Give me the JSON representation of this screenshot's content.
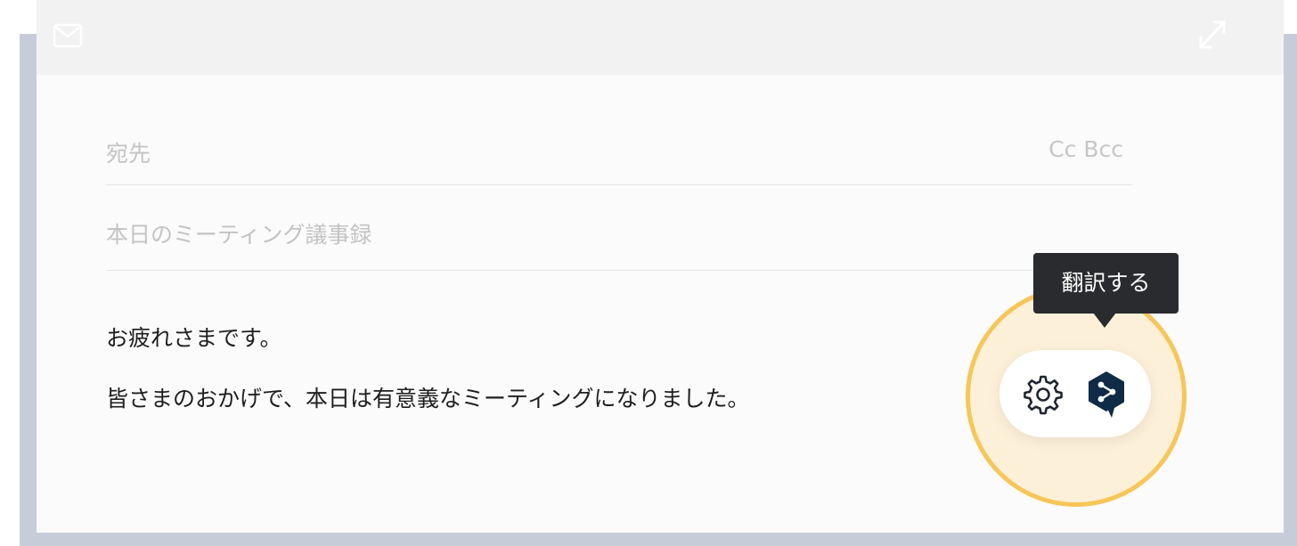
{
  "header": {
    "mail_icon": "envelope-icon",
    "expand_icon": "expand-diagonal-icon"
  },
  "fields": {
    "to_placeholder": "宛先",
    "cc_bcc": "Cc Bcc",
    "subject": "本日のミーティング議事録"
  },
  "body": {
    "line1": "お疲れさまです。",
    "line2": "皆さまのおかげで、本日は有意義なミーティングになりました。"
  },
  "translate_widget": {
    "tooltip": "翻訳する",
    "settings_icon": "gear-icon",
    "translate_icon": "deepl-logo-icon",
    "ring_color": "#f7c659",
    "logo_color": "#0f2b46"
  }
}
